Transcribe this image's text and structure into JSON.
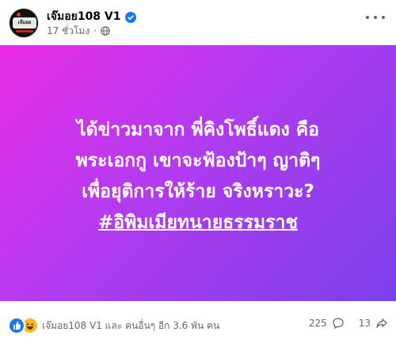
{
  "header": {
    "page_name": "เจ๊มอย108 V1",
    "timestamp": "17 ชั่วโมง",
    "separator": "·",
    "avatar_text": "เจ๊มอย"
  },
  "post": {
    "lines": [
      "ได้ข่าวมาจาก พี่คิงโพธิ์แดง คือ",
      "พระเอกกู เขาจะฟ้องป้าๆ ญาติๆ",
      "เพื่อยุติการให้ร้าย จริงหราวะ?"
    ],
    "hashtag": "#อิพิมเมียทนายธรรมราช",
    "background_colors": [
      "#e82ee6",
      "#b23bf0",
      "#7a40ea"
    ]
  },
  "footer": {
    "reaction_text": "เจ๊มอย108 V1 และ คนอื่นๆ อีก 3.6 พัน คน",
    "comments_count": "225",
    "shares_count": "13",
    "icons": [
      "like-icon",
      "haha-icon",
      "comment-icon",
      "share-icon"
    ]
  }
}
